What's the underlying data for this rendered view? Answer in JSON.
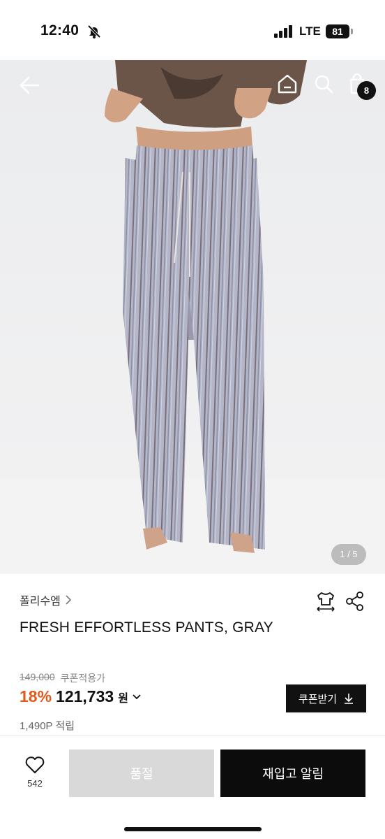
{
  "status_bar": {
    "time": "12:40",
    "network": "LTE",
    "battery": "81",
    "icons": [
      "bell-slash-icon",
      "signal-bars-icon",
      "battery-icon"
    ]
  },
  "header": {
    "icons": [
      "arrow-left-icon",
      "home-icon",
      "search-icon",
      "shopping-bag-icon"
    ],
    "cart_count": "8"
  },
  "gallery": {
    "page_indicator": "1 / 5",
    "image_alt": "striped wide-leg pants worn by model"
  },
  "product": {
    "brand": "폴리수엠",
    "title": "FRESH EFFORTLESS PANTS, GRAY",
    "original_price": "149,000",
    "coupon_label": "쿠폰적용가",
    "discount": "18%",
    "price": "121,733",
    "currency": "원",
    "points": "1,490P 적립",
    "coupon_button": "쿠폰받기",
    "tool_icons": [
      "size-guide-icon",
      "share-icon"
    ]
  },
  "bottom_bar": {
    "like_count": "542",
    "soldout_label": "품절",
    "restock_label": "재입고 알림"
  },
  "colors": {
    "discount": "#e25a1c",
    "primary": "#0c0c0c",
    "disabled": "#d9d9d9",
    "accent": "#111111"
  }
}
